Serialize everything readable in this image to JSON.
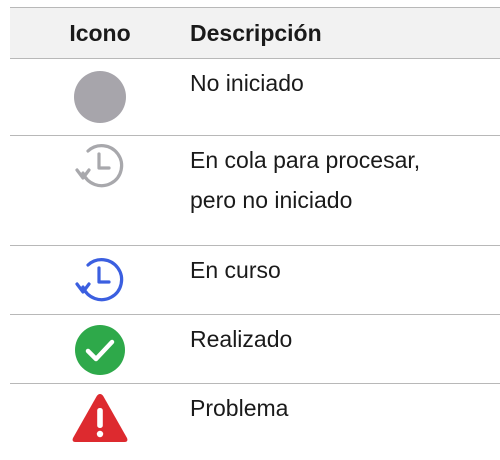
{
  "table": {
    "headers": {
      "icon": "Icono",
      "description": "Descripción"
    },
    "rows": [
      {
        "icon": "gray-circle-icon",
        "description": "No iniciado",
        "color": "#a7a5ab"
      },
      {
        "icon": "gray-clock-icon",
        "description": "En cola para procesar,\npero no iniciado",
        "color": "#a8a8ac"
      },
      {
        "icon": "blue-clock-icon",
        "description": "En curso",
        "color": "#3b5fe0"
      },
      {
        "icon": "green-check-icon",
        "description": "Realizado",
        "color": "#2ea94a"
      },
      {
        "icon": "red-warning-icon",
        "description": "Problema",
        "color": "#dd2a2f"
      }
    ]
  }
}
